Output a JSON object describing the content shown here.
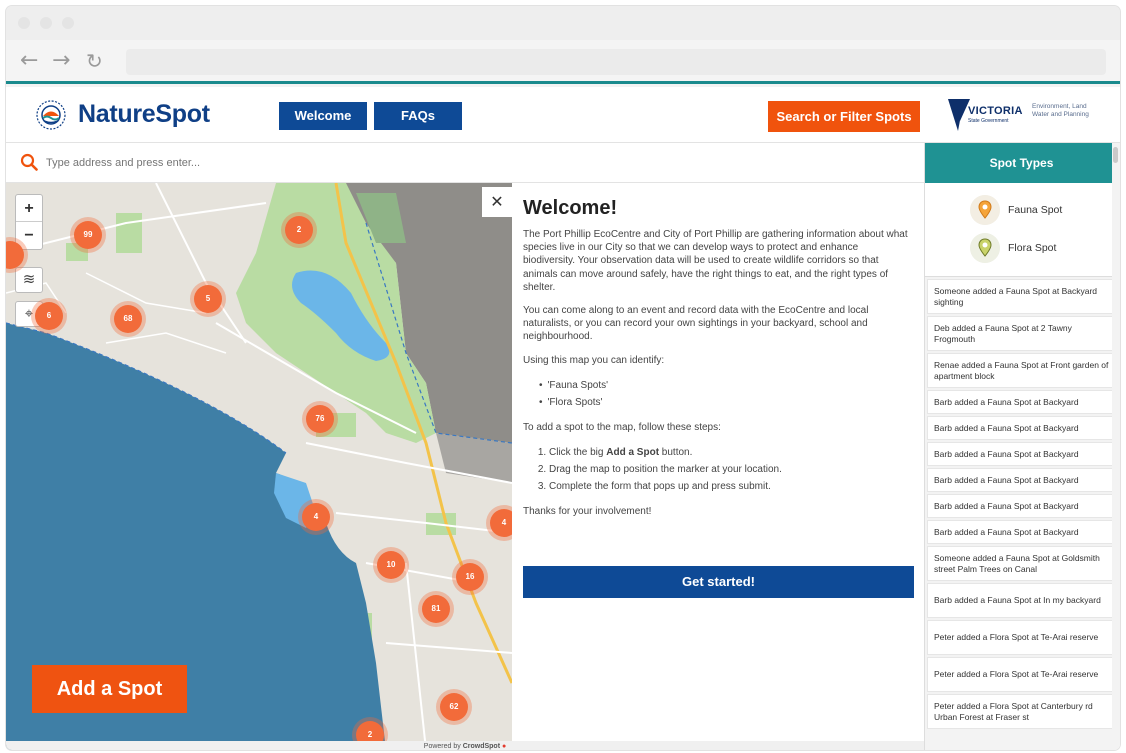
{
  "browser": {
    "back_glyph": "←",
    "forward_glyph": "→",
    "reload_glyph": "↻"
  },
  "header": {
    "brand": "NatureSpot",
    "nav": [
      {
        "label": "Welcome"
      },
      {
        "label": "FAQs"
      }
    ],
    "search_filter_label": "Search or Filter Spots",
    "vic_logo_text": "VICTORIA",
    "vic_logo_sub": "State Government",
    "dept_text": "Environment, Land Water and Planning"
  },
  "search": {
    "placeholder": "Type address and press enter..."
  },
  "map": {
    "zoom_in": "+",
    "zoom_out": "−",
    "layers_glyph": "≋",
    "locate_glyph": "⌖",
    "clusters": [
      "99",
      "2",
      "5",
      "68",
      "6",
      "76",
      "4",
      "10",
      "16",
      "81",
      "62",
      "2",
      "4"
    ],
    "add_spot_label": "Add a Spot"
  },
  "welcome": {
    "close_glyph": "✕",
    "title": "Welcome!",
    "p1": "The Port Phillip EcoCentre and City of Port Phillip are gathering information about what species live in our City so that we can develop ways to protect and enhance biodiversity. Your observation data will be used to create wildlife corridors so that animals can move around safely, have the right things to eat, and the right types of shelter.",
    "p2": "You can come along to an event and record data with the EcoCentre and local naturalists, or you can record your own sightings in your backyard, school and neighbourhood.",
    "p3": "Using this map you can identify:",
    "identify": [
      "'Fauna Spots'",
      "'Flora Spots'"
    ],
    "p4": "To add a spot to the map, follow these steps:",
    "step1_pre": "Click the big ",
    "step1_bold": "Add a Spot",
    "step1_post": " button.",
    "step2": "Drag the map to position the marker at your location.",
    "step3": "Complete the form that pops up and press submit.",
    "thanks": "Thanks for your involvement!",
    "cta": "Get started!"
  },
  "sidebar": {
    "title": "Spot Types",
    "types": [
      {
        "label": "Fauna Spot"
      },
      {
        "label": "Flora Spot"
      }
    ],
    "activity": [
      "Someone added a Fauna Spot at Backyard sighting",
      "Deb added a Fauna Spot at 2 Tawny Frogmouth",
      "Renae added a Fauna Spot at Front garden of apartment block",
      "Barb added a Fauna Spot at Backyard",
      "Barb added a Fauna Spot at Backyard",
      "Barb added a Fauna Spot at Backyard",
      "Barb added a Fauna Spot at Backyard",
      "Barb added a Fauna Spot at Backyard",
      "Barb added a Fauna Spot at Backyard",
      "Someone added a Fauna Spot at Goldsmith street Palm Trees on Canal",
      "Barb added a Fauna Spot at In my backyard",
      "Peter added a Flora Spot at Te-Arai reserve",
      "Peter added a Flora Spot at Te-Arai reserve",
      "Peter added a Flora Spot at Canterbury rd Urban Forest at Fraser st"
    ]
  },
  "footer": {
    "powered_by": "Powered by",
    "brand": "CrowdSpot"
  },
  "colors": {
    "brand_blue": "#0e4a96",
    "accent_orange": "#f0530d",
    "teal": "#1f9293"
  }
}
